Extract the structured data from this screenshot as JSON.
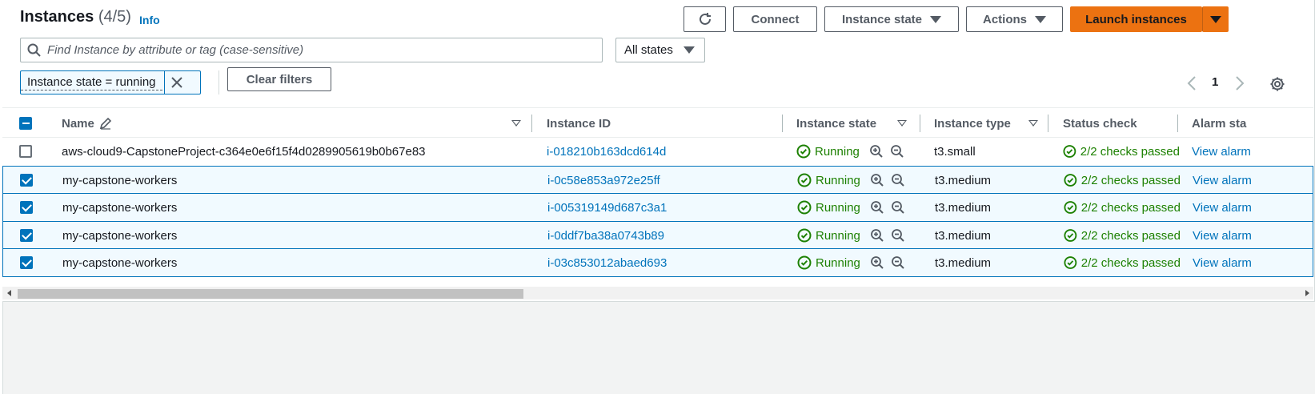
{
  "header": {
    "title": "Instances",
    "count": "(4/5)",
    "info_label": "Info"
  },
  "toolbar": {
    "connect_label": "Connect",
    "instance_state_label": "Instance state",
    "actions_label": "Actions",
    "launch_label": "Launch instances"
  },
  "search": {
    "placeholder": "Find Instance by attribute or tag (case-sensitive)",
    "value": ""
  },
  "state_filter": {
    "selected": "All states"
  },
  "filter_token": {
    "label": "Instance state = running"
  },
  "clear_filters_label": "Clear filters",
  "pagination": {
    "current_page": "1"
  },
  "table": {
    "columns": [
      "Name",
      "Instance ID",
      "Instance state",
      "Instance type",
      "Status check",
      "Alarm sta"
    ],
    "rows": [
      {
        "selected": false,
        "name": "aws-cloud9-CapstoneProject-c364e0e6f15f4d0289905619b0b67e83",
        "instance_id": "i-018210b163dcd614d",
        "state": "Running",
        "type": "t3.small",
        "status_check": "2/2 checks passed",
        "alarm": "View alarm"
      },
      {
        "selected": true,
        "name": "my-capstone-workers",
        "instance_id": "i-0c58e853a972e25ff",
        "state": "Running",
        "type": "t3.medium",
        "status_check": "2/2 checks passed",
        "alarm": "View alarm"
      },
      {
        "selected": true,
        "name": "my-capstone-workers",
        "instance_id": "i-005319149d687c3a1",
        "state": "Running",
        "type": "t3.medium",
        "status_check": "2/2 checks passed",
        "alarm": "View alarm"
      },
      {
        "selected": true,
        "name": "my-capstone-workers",
        "instance_id": "i-0ddf7ba38a0743b89",
        "state": "Running",
        "type": "t3.medium",
        "status_check": "2/2 checks passed",
        "alarm": "View alarm"
      },
      {
        "selected": true,
        "name": "my-capstone-workers",
        "instance_id": "i-03c853012abaed693",
        "state": "Running",
        "type": "t3.medium",
        "status_check": "2/2 checks passed",
        "alarm": "View alarm"
      }
    ]
  },
  "colors": {
    "primary": "#ec7211",
    "link": "#0073bb",
    "success": "#1d8102",
    "selected_row_bg": "#f1faff"
  },
  "icons": {
    "refresh": "refresh-icon",
    "search": "search-icon",
    "close": "close-icon",
    "edit": "pencil-icon",
    "zoom_in": "zoom-in-icon",
    "zoom_out": "zoom-out-icon",
    "status_ok": "check-circle-icon",
    "settings": "gear-icon"
  }
}
